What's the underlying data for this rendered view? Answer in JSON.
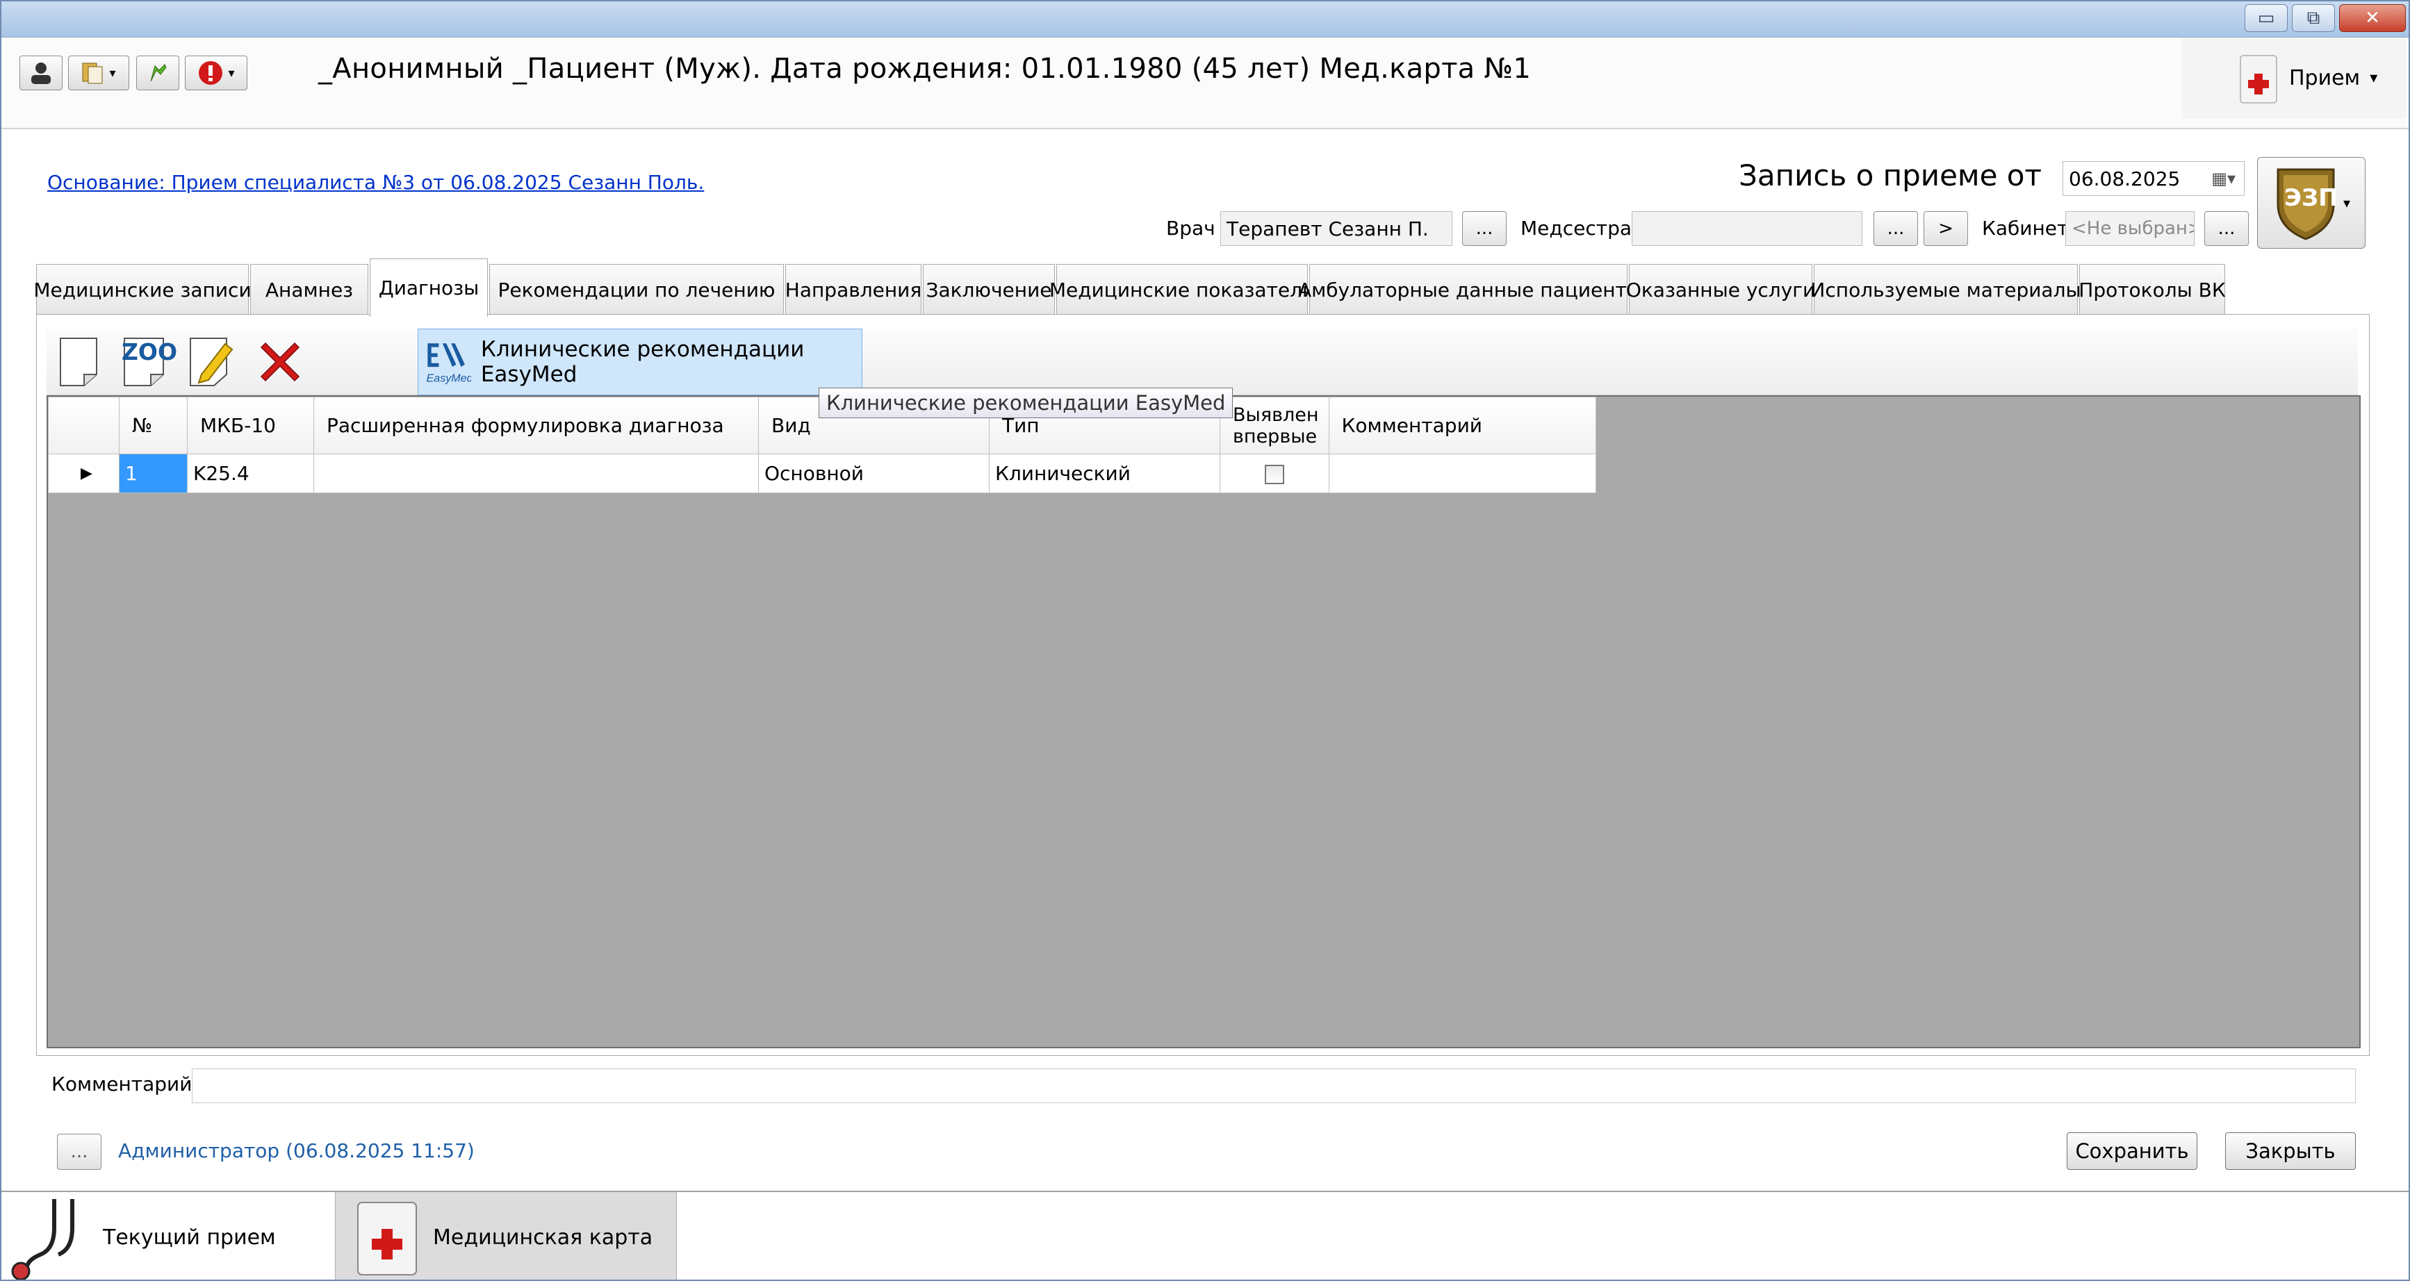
{
  "window": {
    "controls": {
      "minimize": "▭",
      "restore": "⧉",
      "close": "✕"
    }
  },
  "header": {
    "patient_title": "_Анонимный _Пациент  (Муж). Дата рождения: 01.01.1980 (45 лет) Мед.карта №1",
    "priem_label": "Прием",
    "dropdown_arrow": "▾"
  },
  "record": {
    "osnovanie_link": "Основание: Прием специалиста №3 от 06.08.2025 Сезанн Поль.",
    "zapis_label": "Запись о приеме от",
    "date_value": "06.08.2025",
    "ezp_label": "ЭЗП",
    "vrach_label": "Врач",
    "vrach_value": "Терапевт Сезанн П.",
    "medsestra_label": "Медсестра",
    "medsestra_value": "",
    "kabinet_label": "Кабинет",
    "kabinet_value": "<Не выбран>",
    "ellipsis": "...",
    "arrow_btn": ">"
  },
  "tabs": [
    {
      "label": "Медицинские записи"
    },
    {
      "label": "Анамнез"
    },
    {
      "label": "Диагнозы"
    },
    {
      "label": "Рекомендации по лечению"
    },
    {
      "label": "Направления"
    },
    {
      "label": "Заключение"
    },
    {
      "label": "Медицинские показатели"
    },
    {
      "label": "Амбулаторные данные пациента"
    },
    {
      "label": "Оказанные услуги"
    },
    {
      "label": "Используемые материалы"
    },
    {
      "label": "Протоколы ВК"
    }
  ],
  "toolbar": {
    "zoo_label": "ZOO",
    "easymed_label": "Клинические рекомендации EasyMed",
    "easymed_logo_text": "EasyMed",
    "tooltip": "Клинические рекомендации EasyMed"
  },
  "grid": {
    "headers": [
      "№",
      "МКБ-10",
      "Расширенная формулировка диагноза",
      "Вид",
      "Тип",
      "Выявлен впервые",
      "Комментарий"
    ],
    "rows": [
      {
        "num": "1",
        "mkb": "K25.4",
        "formulation": "",
        "vid": "Основной",
        "tip": "Клинический",
        "first": false,
        "comment": ""
      }
    ]
  },
  "footer": {
    "comment_label": "Комментарий",
    "comment_value": "",
    "author": "Администратор (06.08.2025 11:57)",
    "ellipsis": "...",
    "save_label": "Сохранить",
    "close_label": "Закрыть"
  },
  "bottom_tabs": [
    {
      "label": "Текущий прием"
    },
    {
      "label": "Медицинская карта"
    }
  ],
  "colors": {
    "link": "#0033cc",
    "author": "#1f5fa8",
    "grid_bg": "#a9a9a9",
    "selection": "#3399ff"
  }
}
